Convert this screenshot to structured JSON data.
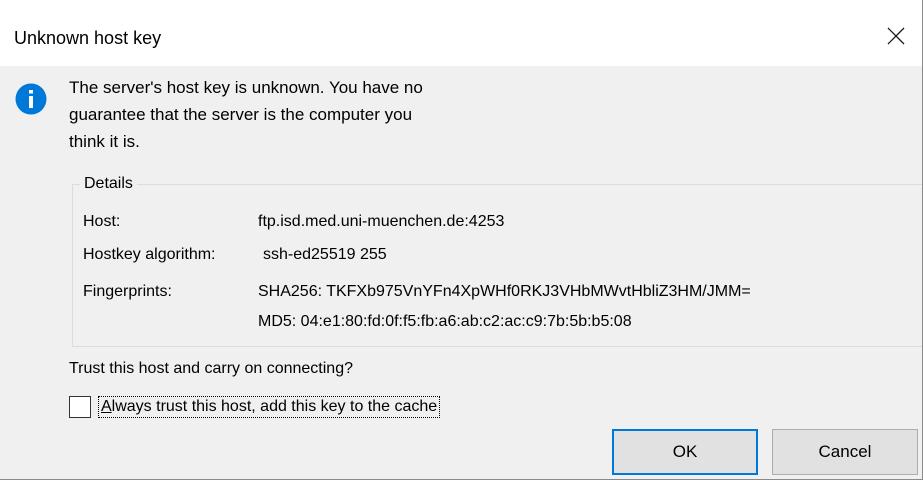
{
  "dialog": {
    "title": "Unknown host key",
    "message_lines": [
      "The server's host key is unknown. You have no",
      "guarantee that the server is the computer you",
      "think it is."
    ],
    "details": {
      "legend": "Details",
      "host_label": "Host:",
      "host_value": "ftp.isd.med.uni-muenchen.de:4253",
      "algorithm_label": "Hostkey algorithm:",
      "algorithm_value": "ssh-ed25519 255",
      "fingerprints_label": "Fingerprints:",
      "fingerprint_sha256": "SHA256: TKFXb975VnYFn4XpWHf0RKJ3VHbMWvtHbliZ3HM/JMM=",
      "fingerprint_md5": "MD5: 04:e1:80:fd:0f:f5:fb:a6:ab:c2:ac:c9:7b:5b:b5:08"
    },
    "question": "Trust this host and carry on connecting?",
    "checkbox": {
      "mnemonic": "A",
      "label_rest": "lways trust this host, add this key to the cache",
      "checked": false
    },
    "buttons": {
      "ok": "OK",
      "cancel": "Cancel"
    }
  },
  "icons": {
    "info": "info-icon",
    "close": "close-icon"
  },
  "colors": {
    "info_blue": "#0078d7",
    "focus_border": "#0078d7",
    "client_bg": "#f0f0f0"
  }
}
